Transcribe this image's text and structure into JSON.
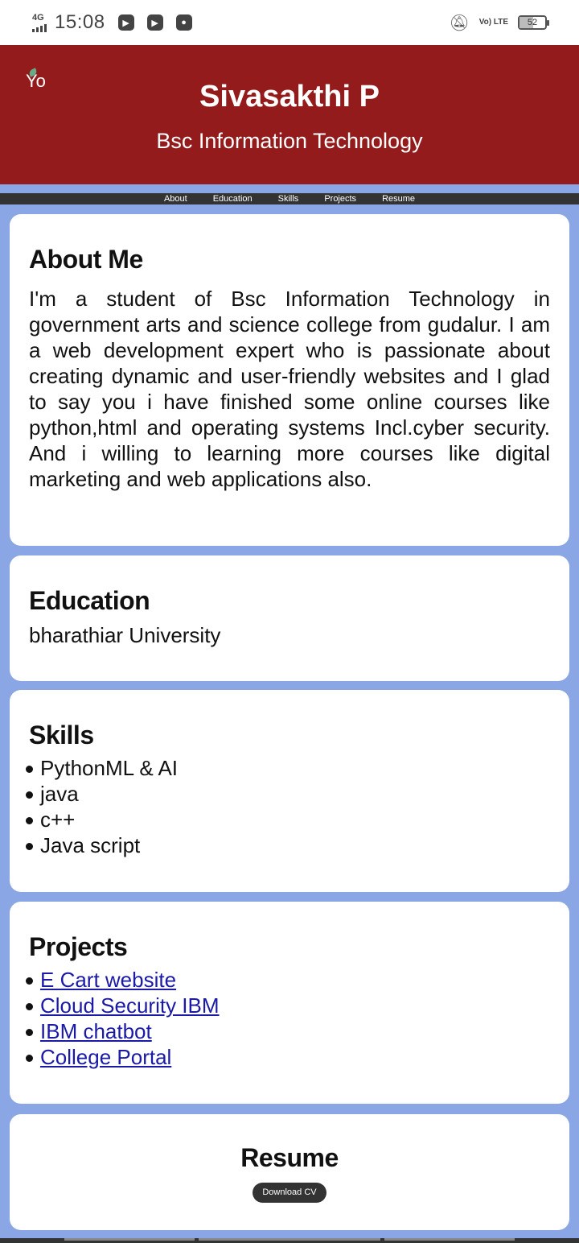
{
  "status_bar": {
    "network": "4G",
    "time": "15:08",
    "lte": "Vo) LTE",
    "battery": "52"
  },
  "header": {
    "logo_text": "Yo",
    "name": "Sivasakthi P",
    "subtitle": "Bsc Information Technology"
  },
  "nav": {
    "items": [
      "About",
      "Education",
      "Skills",
      "Projects",
      "Resume"
    ]
  },
  "about": {
    "title": "About Me",
    "text": "I'm a student of Bsc Information Technology in government arts and science college from gudalur. I am a web development expert who is passionate about creating dynamic and user-friendly websites and I glad to say you i have finished some online courses like python,html and operating systems Incl.cyber security. And i willing to learning more courses like digital marketing and web applications also."
  },
  "education": {
    "title": "Education",
    "text": "bharathiar University"
  },
  "skills": {
    "title": "Skills",
    "items": [
      "PythonML & AI",
      "java",
      "c++",
      "Java script"
    ]
  },
  "projects": {
    "title": "Projects",
    "items": [
      "E Cart website",
      "Cloud Security IBM",
      "IBM chatbot",
      "College Portal"
    ]
  },
  "resume": {
    "title": "Resume",
    "button_label": "Download CV"
  }
}
